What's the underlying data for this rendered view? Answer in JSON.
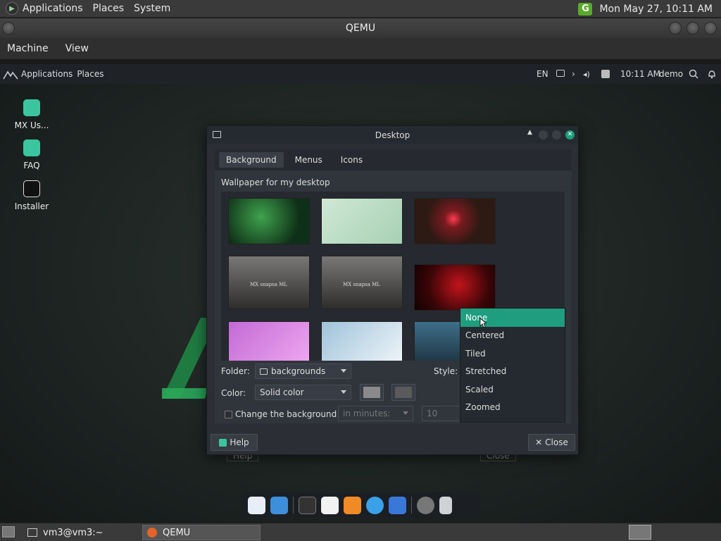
{
  "host": {
    "menu": {
      "applications": "Applications",
      "places": "Places",
      "system": "System"
    },
    "clock": "Mon May 27, 10:11 AM"
  },
  "qemu": {
    "title": "QEMU",
    "menu": {
      "machine": "Machine",
      "view": "View"
    }
  },
  "vm": {
    "panel": {
      "applications": "Applications",
      "places": "Places",
      "lang": "EN",
      "clock": "10:11 AM",
      "user": "demo"
    },
    "desktop_icons": [
      {
        "label": "MX Us...",
        "icon": "mx-user-icon"
      },
      {
        "label": "FAQ",
        "icon": "faq-icon"
      },
      {
        "label": "Installer",
        "icon": "installer-icon"
      }
    ],
    "dialog": {
      "title": "Desktop",
      "tabs": [
        "Background",
        "Menus",
        "Icons"
      ],
      "wallpaper_label": "Wallpaper for my desktop",
      "folder_label": "Folder:",
      "folder_value": "backgrounds",
      "style_label": "Style:",
      "color_label": "Color:",
      "color_value": "Solid color",
      "change_label": "Change the background",
      "interval_value": "in minutes:",
      "minutes_value": "10",
      "help_label": "Help",
      "close_label": "Close",
      "ghost_help": "Help",
      "ghost_close": "Close",
      "wallpaper_watermark": "MX snapsa ML"
    },
    "style_options": [
      "None",
      "Centered",
      "Tiled",
      "Stretched",
      "Scaled",
      "Zoomed"
    ],
    "style_selected": "None"
  },
  "taskbar": {
    "items": [
      "vm3@vm3:~",
      "QEMU"
    ]
  },
  "colors": {
    "accent": "#1f9d7f",
    "host_green": "#5aaa2c"
  }
}
